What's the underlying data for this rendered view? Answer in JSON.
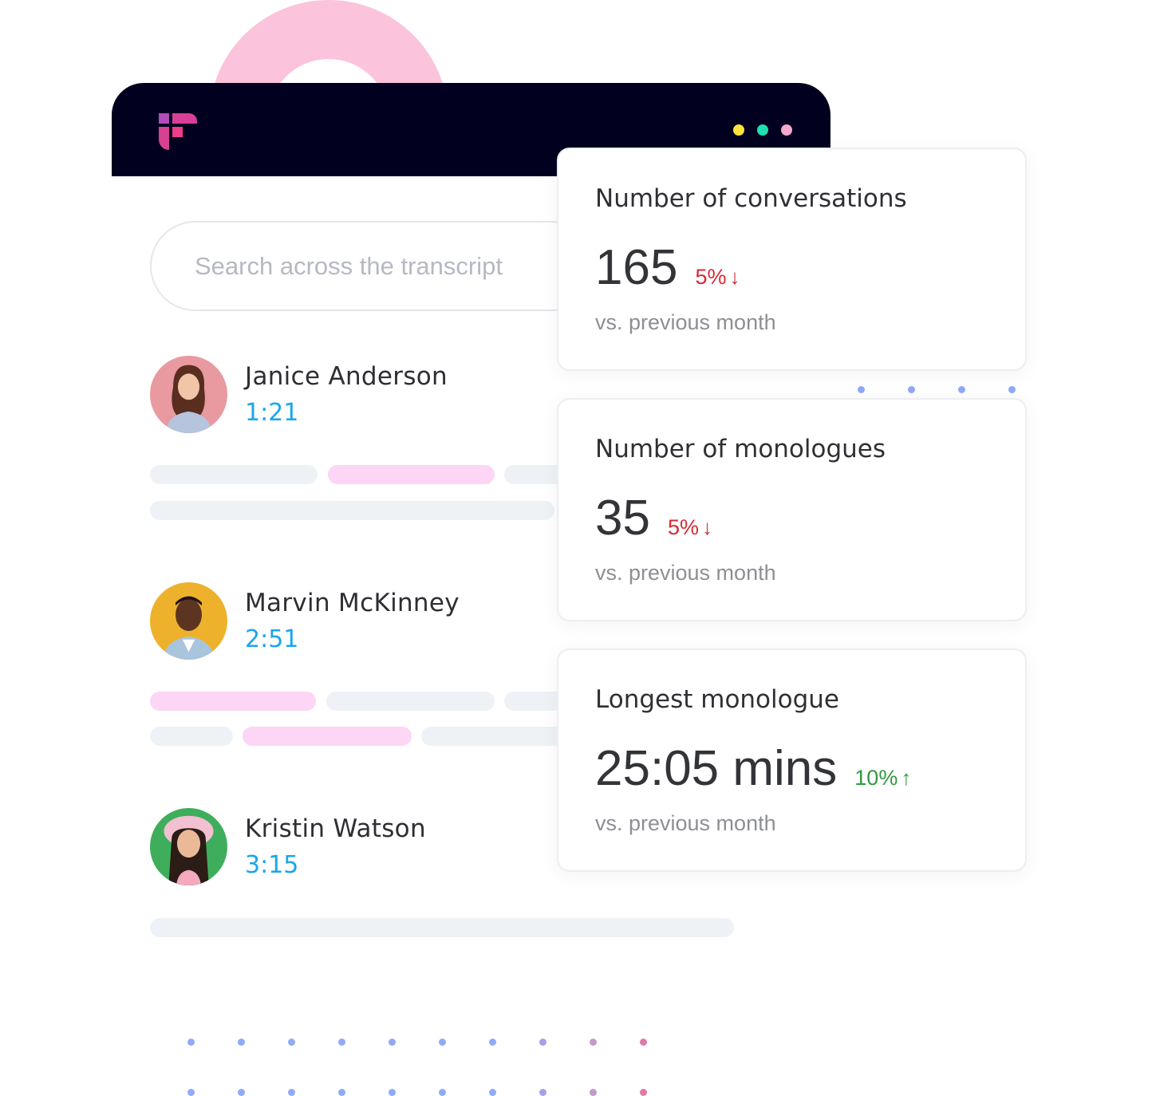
{
  "app": {
    "logo_icon": "brand-logo-icon",
    "window_controls": [
      {
        "name": "yellow-dot",
        "color": "#fde43a"
      },
      {
        "name": "teal-dot",
        "color": "#1fe0b0"
      },
      {
        "name": "pink-dot",
        "color": "#f7a8cf"
      }
    ]
  },
  "search": {
    "placeholder": "Search across the transcript",
    "value": ""
  },
  "speakers": [
    {
      "name": "Janice Anderson",
      "duration": "1:21",
      "avatar_bg": "#e89aa0"
    },
    {
      "name": "Marvin McKinney",
      "duration": "2:51",
      "avatar_bg": "#edb12c"
    },
    {
      "name": "Kristin Watson",
      "duration": "3:15",
      "avatar_bg": "#3fae5c"
    }
  ],
  "stats": [
    {
      "title": "Number of conversations",
      "value": "165",
      "change": "5%",
      "direction": "down",
      "subtitle": "vs. previous month"
    },
    {
      "title": "Number of monologues",
      "value": "35",
      "change": "5%",
      "direction": "down",
      "subtitle": "vs. previous month"
    },
    {
      "title": "Longest monologue",
      "value": "25:05 mins",
      "change": "10%",
      "direction": "up",
      "subtitle": "vs. previous month"
    }
  ],
  "colors": {
    "header_bg": "#02001f",
    "accent_pink": "#fbc3dc",
    "time_blue": "#1aa6ec",
    "negative": "#d62a35",
    "positive": "#2e9b3e"
  },
  "arrows": {
    "down": "↓",
    "up": "↑"
  }
}
